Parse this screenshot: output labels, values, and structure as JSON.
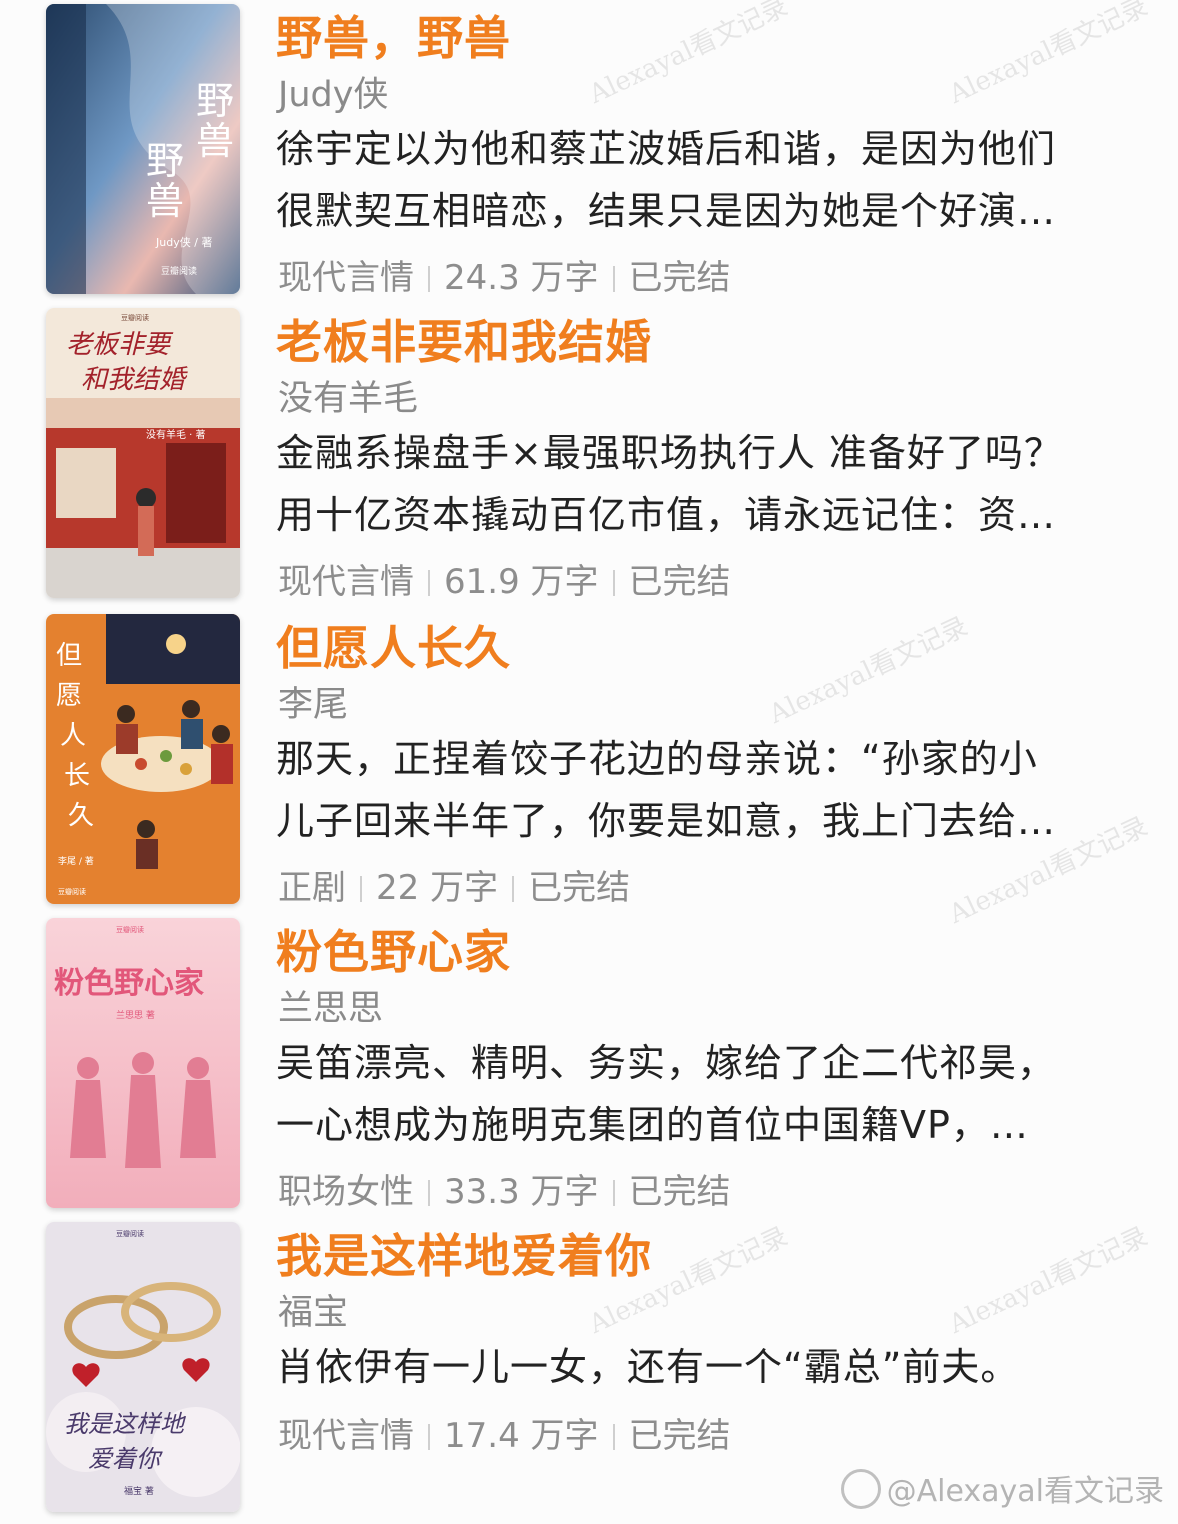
{
  "books": [
    {
      "title": "野兽，野兽",
      "author": "Judy侠",
      "desc_lines": [
        "徐宇定以为他和蔡芷波婚后和谐，是因为他们",
        "很默契互相暗恋，结果只是因为她是个好演…"
      ],
      "genre": "现代言情",
      "words": "24.3 万字",
      "status": "已完结",
      "cover": {
        "title_text": "野兽野兽",
        "author_text": "Judy侠 / 著",
        "publisher": "豆瓣阅读",
        "colors": [
          "#2e4f73",
          "#6e98c3",
          "#f1b7a6"
        ]
      }
    },
    {
      "title": "老板非要和我结婚",
      "author": "没有羊毛",
      "desc_lines": [
        "金融系操盘手×最强职场执行人 准备好了吗？",
        "用十亿资本撬动百亿市值，请永远记住：资…"
      ],
      "genre": "现代言情",
      "words": "61.9 万字",
      "status": "已完结",
      "cover": {
        "title_text": "老板非要和我结婚",
        "author_text": "没有羊毛 · 著",
        "publisher": "豆瓣阅读",
        "colors": [
          "#f2e6d8",
          "#c0392b",
          "#3d6e5e"
        ]
      }
    },
    {
      "title": "但愿人长久",
      "author": "李尾",
      "desc_lines": [
        "那天，正捏着饺子花边的母亲说：“孙家的小",
        "儿子回来半年了，你要是如意，我上门去给…"
      ],
      "genre": "正剧",
      "words": "22 万字",
      "status": "已完结",
      "cover": {
        "title_text": "但愿人长久",
        "author_text": "李尾 / 著",
        "publisher": "豆瓣阅读",
        "colors": [
          "#e07a2c",
          "#2b2f4a",
          "#f4c77a"
        ]
      }
    },
    {
      "title": "粉色野心家",
      "author": "兰思思",
      "desc_lines": [
        "吴笛漂亮、精明、务实，嫁给了企二代祁昊，",
        "一心想成为施明克集团的首位中国籍VP，…"
      ],
      "genre": "职场女性",
      "words": "33.3 万字",
      "status": "已完结",
      "cover": {
        "title_text": "粉色野心家",
        "author_text": "兰思思 著",
        "publisher": "豆瓣阅读",
        "colors": [
          "#f7c7cf",
          "#e8798d",
          "#d45b73"
        ]
      }
    },
    {
      "title": "我是这样地爱着你",
      "author": "福宝",
      "desc_lines": [
        "肖依伊有一儿一女，还有一个“霸总”前夫。"
      ],
      "genre": "现代言情",
      "words": "17.4 万字",
      "status": "已完结",
      "cover": {
        "title_text": "我是这样地爱着你",
        "author_text": "福宝 著",
        "publisher": "豆瓣阅读",
        "colors": [
          "#e9e4ea",
          "#c9a36b",
          "#c0202a"
        ]
      }
    }
  ],
  "watermark": "Alexayal看文记录",
  "credit": "@Alexayal看文记录"
}
